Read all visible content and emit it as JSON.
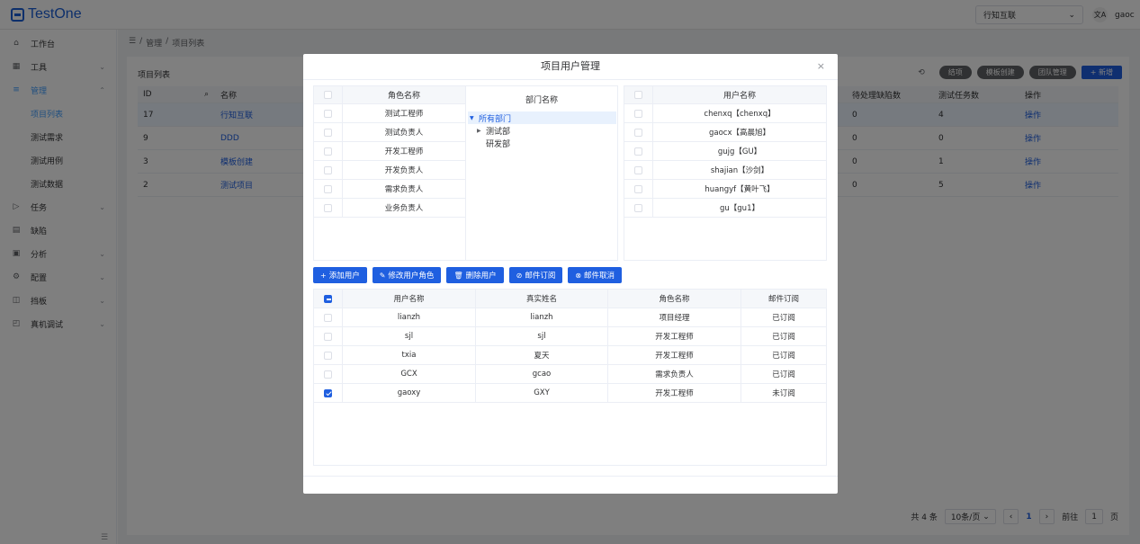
{
  "app": {
    "logo": "TestOne",
    "project_select": "行知互联",
    "user": "gaoc",
    "translate_glyph": "文A"
  },
  "sidebar": {
    "items": [
      {
        "label": "工作台",
        "icon": "home-icon",
        "glyph": "⌂",
        "chevron": ""
      },
      {
        "label": "工具",
        "icon": "grid-icon",
        "glyph": "▦",
        "chevron": "⌄"
      },
      {
        "label": "管理",
        "icon": "list-icon",
        "glyph": "≡",
        "chevron": "⌃"
      }
    ],
    "sub_items": [
      "项目列表",
      "测试需求",
      "测试用例",
      "测试数据"
    ],
    "items2": [
      {
        "label": "任务",
        "icon": "play-icon",
        "glyph": "▷",
        "chevron": "⌄"
      },
      {
        "label": "缺陷",
        "icon": "doc-icon",
        "glyph": "▤",
        "chevron": ""
      },
      {
        "label": "分析",
        "icon": "calendar-icon",
        "glyph": "▣",
        "chevron": "⌄"
      },
      {
        "label": "配置",
        "icon": "gear-icon",
        "glyph": "⚙",
        "chevron": "⌄"
      },
      {
        "label": "挡板",
        "icon": "board-icon",
        "glyph": "◫",
        "chevron": "⌄"
      },
      {
        "label": "真机调试",
        "icon": "device-icon",
        "glyph": "◰",
        "chevron": "⌄"
      }
    ],
    "collapse_glyph": "☰"
  },
  "breadcrumb": {
    "home": "☰",
    "sep": "/",
    "level1": "管理",
    "level2": "项目列表"
  },
  "page": {
    "title": "项目列表",
    "refresh_glyph": "⟲",
    "buttons": [
      "结项",
      "模板创建",
      "团队管理"
    ],
    "new_button": "+ 新增",
    "table_headers": {
      "id": "ID",
      "search_glyph": "⌕",
      "name": "名称",
      "pending": "待处理缺陷数",
      "tasks": "测试任务数",
      "ops": "操作"
    },
    "rows": [
      {
        "id": "17",
        "name": "行知互联",
        "pending": "0",
        "tasks": "4",
        "ops": "操作"
      },
      {
        "id": "9",
        "name": "DDD",
        "pending": "0",
        "tasks": "0",
        "ops": "操作"
      },
      {
        "id": "3",
        "name": "模板创建",
        "pending": "0",
        "tasks": "1",
        "ops": "操作"
      },
      {
        "id": "2",
        "name": "测试项目",
        "pending": "0",
        "tasks": "5",
        "ops": "操作"
      }
    ],
    "pager": {
      "total": "共 4 条",
      "page_size": "10条/页",
      "prev": "‹",
      "current": "1",
      "next": "›",
      "goto_label": "前往",
      "goto_value": "1",
      "goto_suffix": "页"
    }
  },
  "modal": {
    "title": "项目用户管理",
    "close_glyph": "×",
    "role_header": "角色名称",
    "roles": [
      "测试工程师",
      "测试负责人",
      "开发工程师",
      "开发负责人",
      "需求负责人",
      "业务负责人"
    ],
    "dept_header": "部门名称",
    "depts": [
      {
        "label": "所有部门",
        "arrow": "▼"
      },
      {
        "label": "测试部",
        "arrow": "▶"
      },
      {
        "label": "研发部",
        "arrow": ""
      }
    ],
    "user_header": "用户名称",
    "users": [
      "chenxq【chenxq】",
      "gaocx【高晨旭】",
      "gujg【GU】",
      "shajian【沙剑】",
      "huangyf【黄叶飞】",
      "gu【gu1】"
    ],
    "actions": [
      {
        "label": "添加用户",
        "glyph": "+"
      },
      {
        "label": "修改用户角色",
        "glyph": "✎"
      },
      {
        "label": "删除用户",
        "glyph": "🗑"
      },
      {
        "label": "邮件订阅",
        "glyph": "⊘"
      },
      {
        "label": "邮件取消",
        "glyph": "⊗"
      }
    ],
    "bottom_headers": [
      "用户名称",
      "真实姓名",
      "角色名称",
      "邮件订阅"
    ],
    "bottom_rows": [
      {
        "user": "lianzh",
        "real": "lianzh",
        "role": "项目经理",
        "sub": "已订阅",
        "checked": false
      },
      {
        "user": "sjl",
        "real": "sjl",
        "role": "开发工程师",
        "sub": "已订阅",
        "checked": false
      },
      {
        "user": "txia",
        "real": "夏天",
        "role": "开发工程师",
        "sub": "已订阅",
        "checked": false
      },
      {
        "user": "GCX",
        "real": "gcao",
        "role": "需求负责人",
        "sub": "已订阅",
        "checked": false
      },
      {
        "user": "gaoxy",
        "real": "GXY",
        "role": "开发工程师",
        "sub": "未订阅",
        "checked": true
      }
    ]
  },
  "colors": {
    "primary": "#1f5fe0",
    "selected_row": "#ecf5ff",
    "mask": "rgba(0,0,0,0.5)"
  }
}
